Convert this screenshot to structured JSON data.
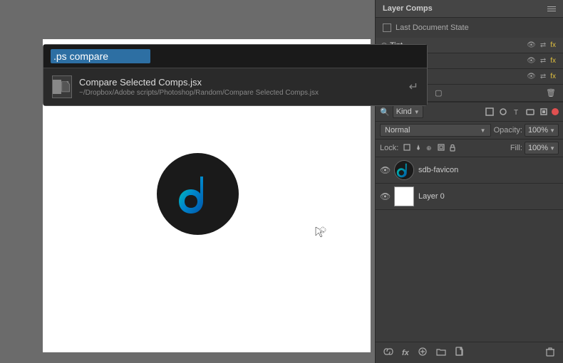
{
  "canvas": {
    "background": "#6b6b6b"
  },
  "script_dialog": {
    "search_placeholder": ".ps compare",
    "search_value": ".ps compare",
    "result": {
      "name": "Compare Selected Comps.jsx",
      "path": "~/Dropbox/Adobe scripts/Photoshop/Random/Compare Selected Comps.jsx"
    }
  },
  "right_panel": {
    "layer_comps": {
      "title": "Layer Comps",
      "last_doc_state_label": "Last Document State",
      "comps": [
        {
          "name": "Tint",
          "visible": true
        },
        {
          "name": "",
          "visible": false
        },
        {
          "name": "",
          "visible": false
        }
      ],
      "toolbar_icons": [
        "arrows-icon",
        "link-icon",
        "refresh-icon",
        "frame-icon",
        "trash-icon"
      ]
    },
    "layers": {
      "filter_label": "Kind",
      "blend_mode": "Normal",
      "opacity_label": "Opacity:",
      "opacity_value": "100%",
      "lock_label": "Lock:",
      "fill_label": "Fill:",
      "fill_value": "100%",
      "layer_list": [
        {
          "name": "sdb-favicon",
          "type": "favicon"
        },
        {
          "name": "Layer 0",
          "type": "white"
        }
      ]
    },
    "bottom_toolbar": {
      "icons": [
        "link-icon",
        "fx-icon",
        "circle-icon",
        "folder-icon",
        "document-icon",
        "trash-icon"
      ]
    }
  }
}
